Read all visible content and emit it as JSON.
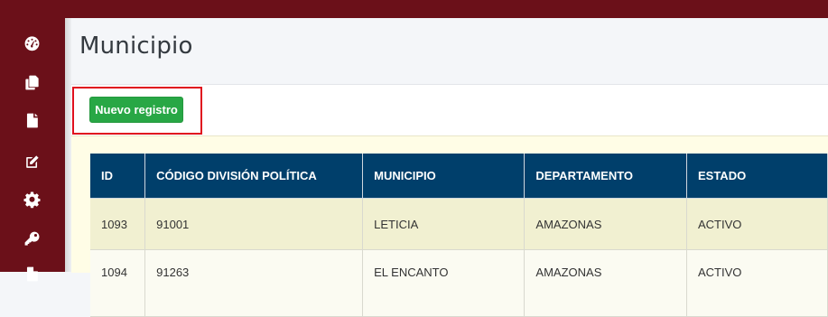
{
  "page": {
    "title": "Municipio",
    "new_button_label": "Nuevo registro"
  },
  "sidebar": {
    "icons": [
      "dashboard-icon",
      "copy-icon",
      "file-icon",
      "edit-icon",
      "gear-icon",
      "key-icon",
      "file-icon"
    ]
  },
  "table": {
    "columns": [
      "ID",
      "CÓDIGO DIVISIÓN POLÍTICA",
      "MUNICIPIO",
      "DEPARTAMENTO",
      "ESTADO"
    ],
    "rows": [
      [
        "1093",
        "91001",
        "LETICIA",
        "AMAZONAS",
        "ACTIVO"
      ],
      [
        "1094",
        "91263",
        "EL ENCANTO",
        "AMAZONAS",
        "ACTIVO"
      ]
    ]
  },
  "colors": {
    "sidebar_bg": "#6b1019",
    "header_bg": "#003f6b",
    "button_green": "#28a745",
    "highlight_red": "#e0101e",
    "row_bg": "#f1f0d1"
  }
}
